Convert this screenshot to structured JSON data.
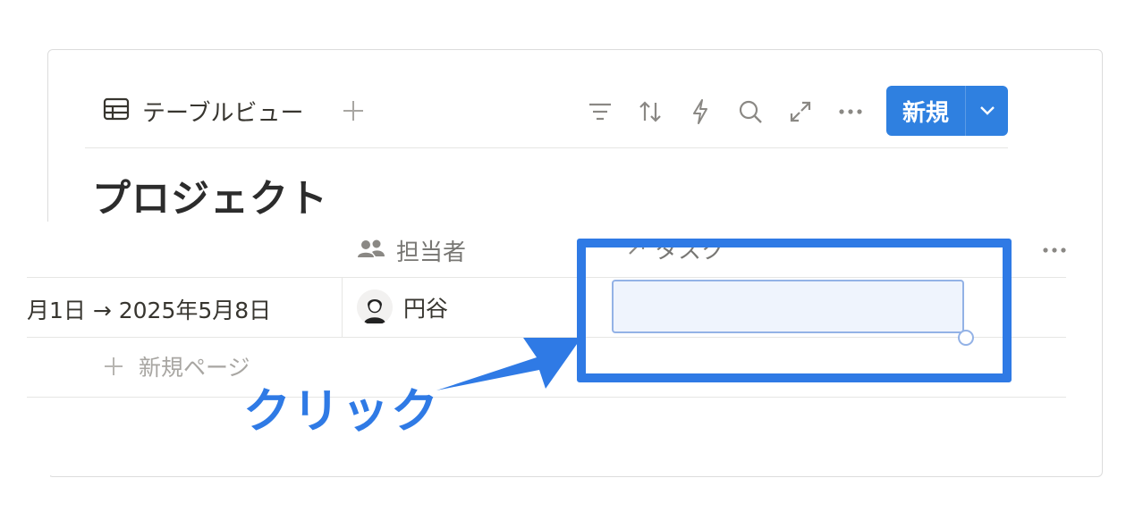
{
  "toolbar": {
    "view_label": "テーブルビュー",
    "icons": [
      "table-icon",
      "plus-icon",
      "filter-icon",
      "sort-icon",
      "lightning-icon",
      "search-icon",
      "expand-icon",
      "more-icon",
      "chevron-down-icon"
    ],
    "new_label": "新規"
  },
  "page": {
    "title": "プロジェクト"
  },
  "table": {
    "columns": [
      {
        "label": "担当者",
        "icon": "people-icon"
      },
      {
        "label": "タスク",
        "icon": "relation-arrow-icon"
      }
    ],
    "rows": [
      {
        "date": "月1日 → 2025年5月8日",
        "assignee": "円谷",
        "task": ""
      }
    ],
    "new_page_label": "新規ページ"
  },
  "annotation": {
    "click_label": "クリック",
    "color": "#2f7ae5"
  },
  "colors": {
    "accent": "#2f80e0",
    "highlight": "#2f7ae5",
    "edit_cell_bg": "#eff4fd"
  }
}
